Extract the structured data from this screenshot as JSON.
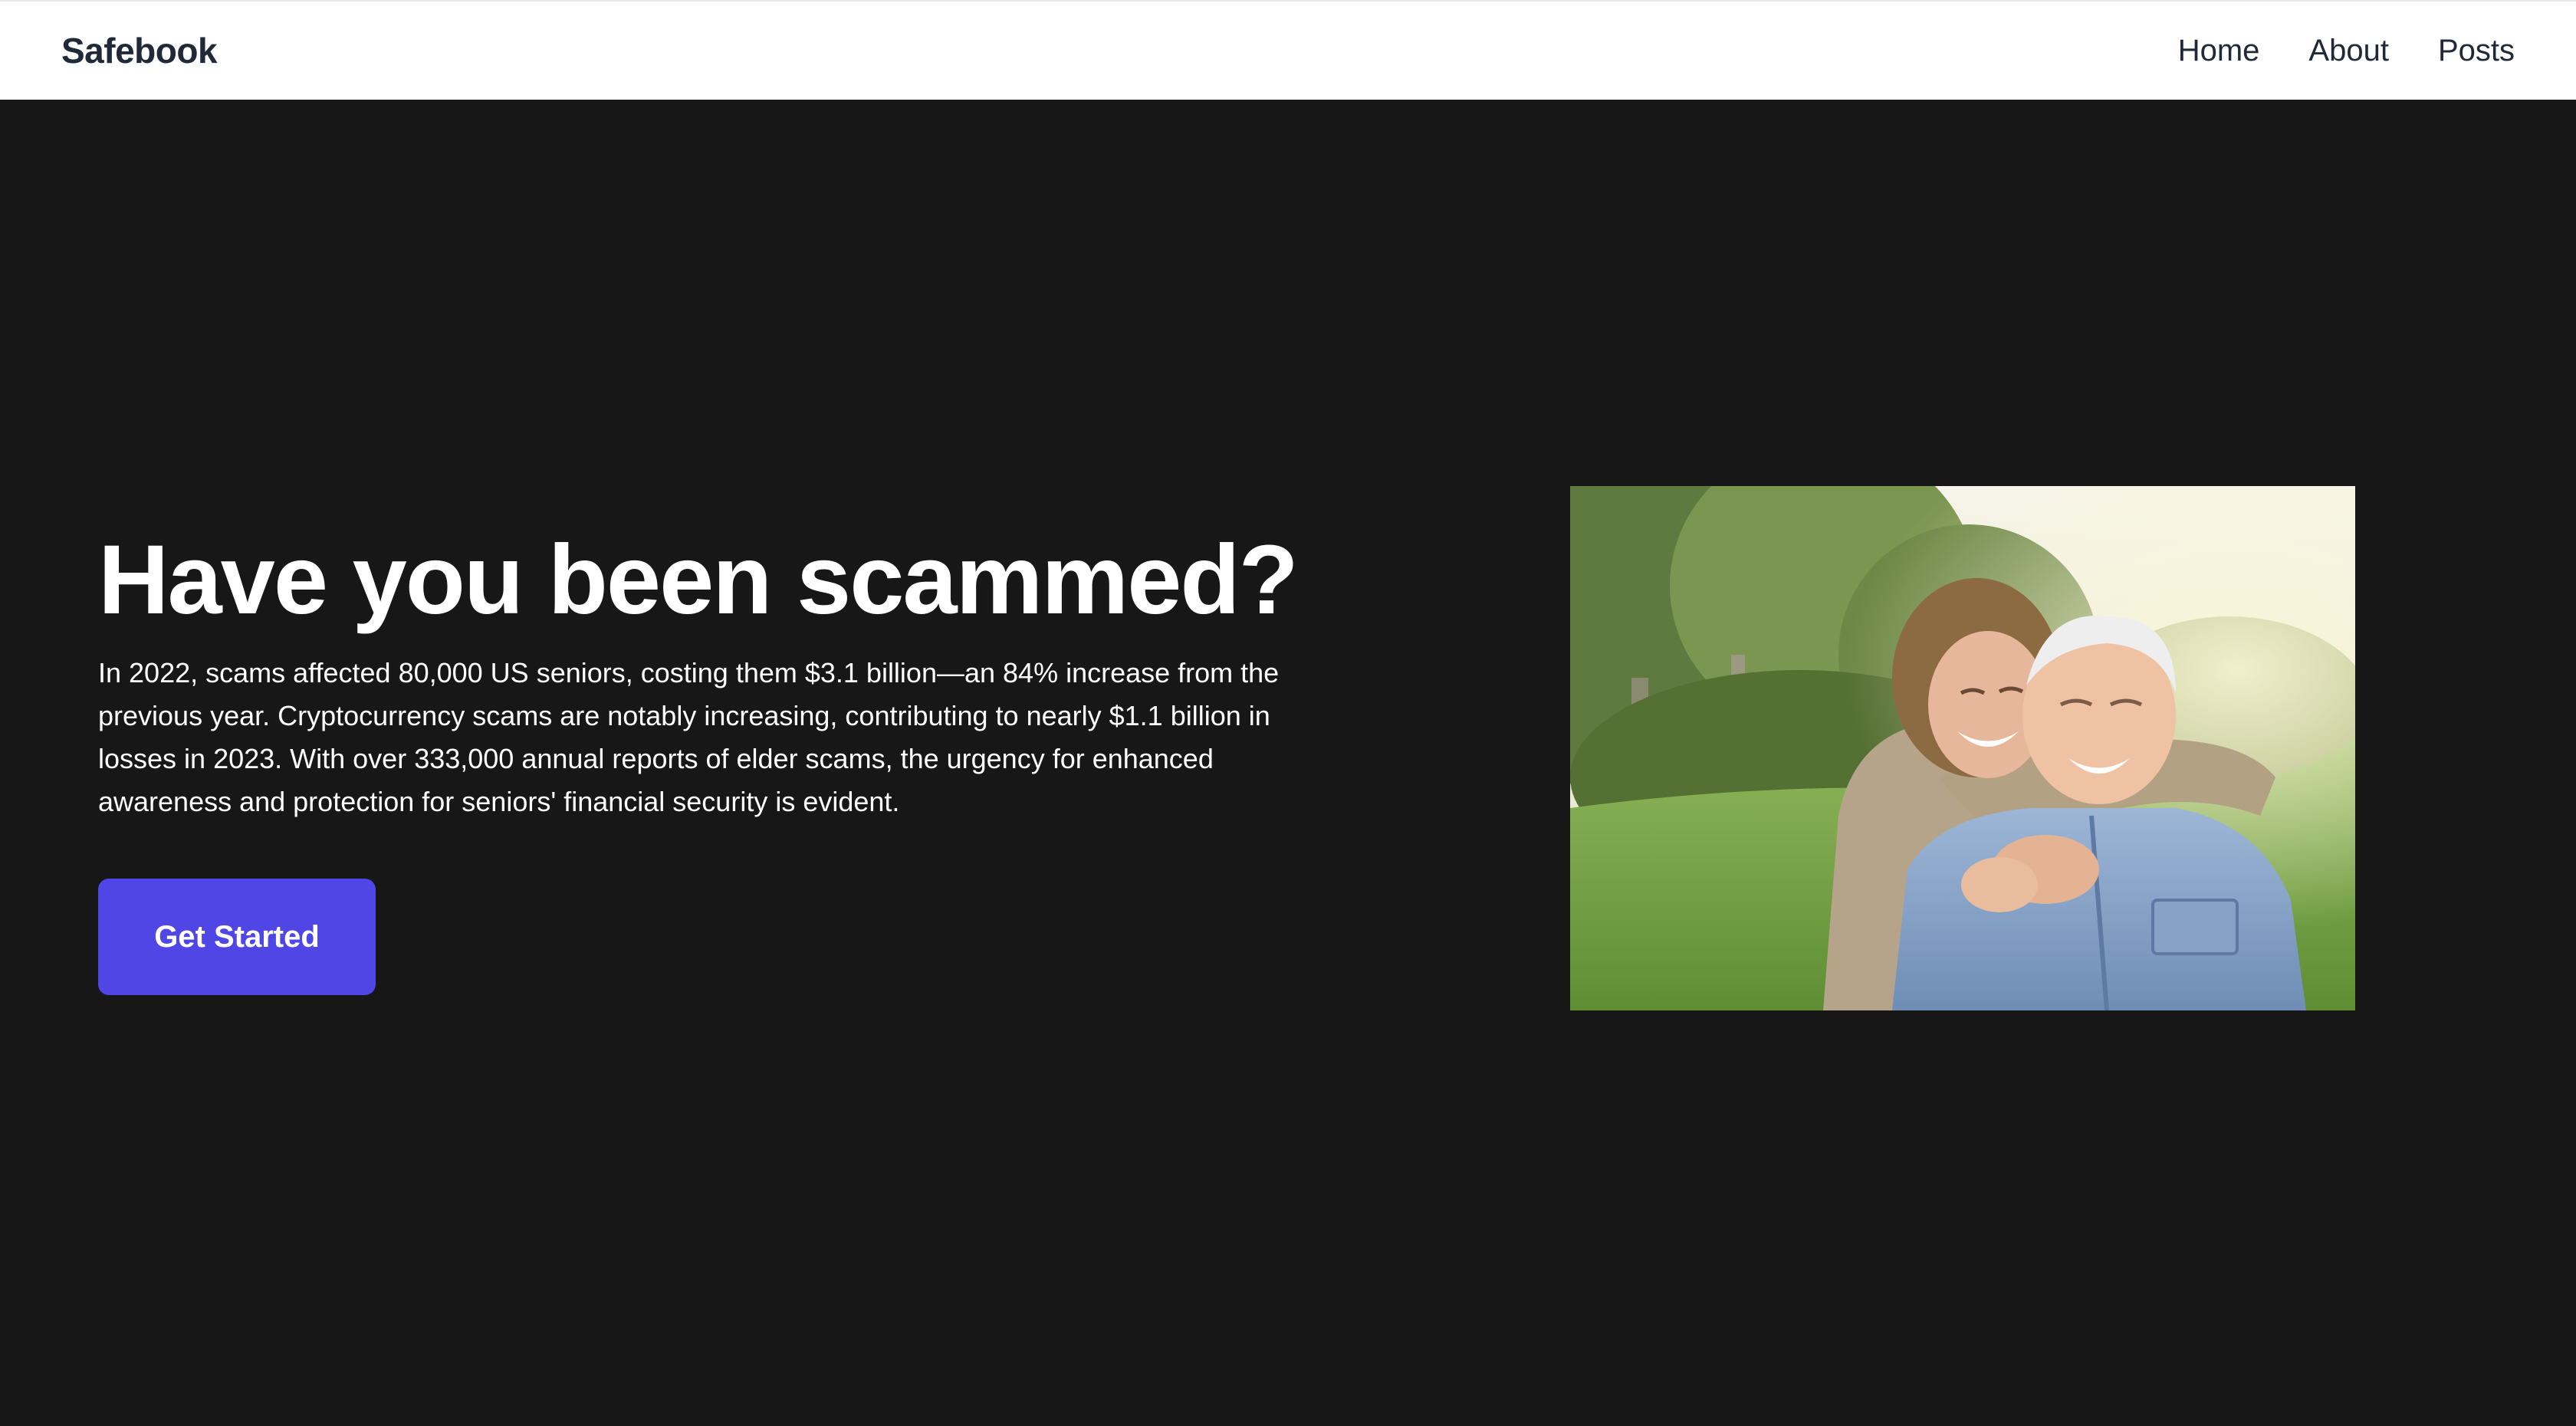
{
  "navbar": {
    "brand": "Safebook",
    "links": [
      {
        "label": "Home"
      },
      {
        "label": "About"
      },
      {
        "label": "Posts"
      }
    ]
  },
  "hero": {
    "title": "Have you been scammed?",
    "description": "In 2022, scams affected 80,000 US seniors, costing them $3.1 billion—an 84% increase from the previous year. Cryptocurrency scams are notably increasing, contributing to nearly $1.1 billion in losses in 2023. With over 333,000 annual reports of elder scams, the urgency for enhanced awareness and protection for seniors' financial security is evident.",
    "cta_label": "Get Started",
    "image": "photo of smiling elderly couple embracing outdoors"
  },
  "colors": {
    "background": "#171717",
    "navbar": "#ffffff",
    "accent": "#4f46e5",
    "text_dark": "#1f2937",
    "text_light": "#ffffff"
  }
}
